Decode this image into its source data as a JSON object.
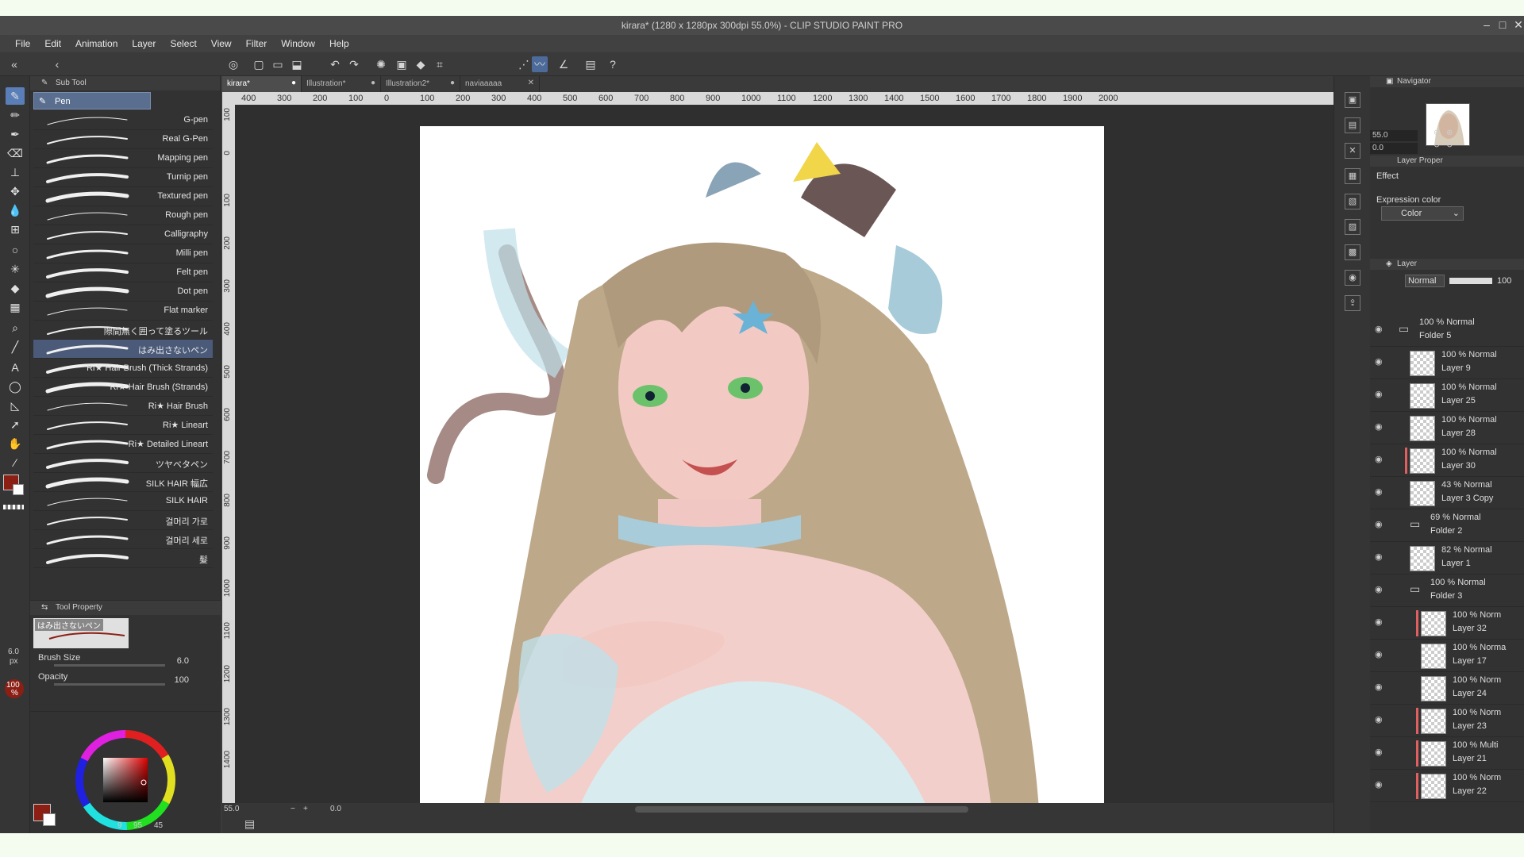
{
  "window": {
    "title": "kirara* (1280 x 1280px 300dpi 55.0%) - CLIP STUDIO PAINT PRO"
  },
  "menu": [
    "File",
    "Edit",
    "Animation",
    "Layer",
    "Select",
    "View",
    "Filter",
    "Window",
    "Help"
  ],
  "subtool": {
    "header": "Sub Tool",
    "active_tab": "Pen",
    "brushes": [
      {
        "label": "G-pen"
      },
      {
        "label": "Real G-Pen"
      },
      {
        "label": "Mapping pen"
      },
      {
        "label": "Turnip pen"
      },
      {
        "label": "Textured pen"
      },
      {
        "label": "Rough pen"
      },
      {
        "label": "Calligraphy"
      },
      {
        "label": "Milli pen"
      },
      {
        "label": "Felt pen"
      },
      {
        "label": "Dot pen"
      },
      {
        "label": "Flat marker"
      },
      {
        "label": "隙間無く囲って塗るツール"
      },
      {
        "label": "はみ出さないペン",
        "selected": true
      },
      {
        "label": "Ri★ Hair Brush (Thick Strands)"
      },
      {
        "label": "Ri★ Hair Brush (Strands)"
      },
      {
        "label": "Ri★ Hair Brush"
      },
      {
        "label": "Ri★ Lineart"
      },
      {
        "label": "Ri★ Detailed Lineart"
      },
      {
        "label": "ツヤベタペン"
      },
      {
        "label": "SILK HAIR 幅広"
      },
      {
        "label": "SILK HAIR"
      },
      {
        "label": "걸머리 가로"
      },
      {
        "label": "걸머리 세로"
      },
      {
        "label": "髮"
      }
    ]
  },
  "tool_property": {
    "header": "Tool Property",
    "preview_name": "はみ出さないペン",
    "brush_size_label": "Brush Size",
    "brush_size_value": "6.0",
    "opacity_label": "Opacity",
    "opacity_value": "100"
  },
  "left_status": {
    "size": "6.0",
    "size_unit": "px",
    "opacity": "100",
    "opacity_unit": "%"
  },
  "color": {
    "main": "#8b1f14",
    "sub": "#ffffff",
    "hsv": [
      "9",
      "95",
      "45"
    ]
  },
  "tabs": [
    "kirara*",
    "Illustration*",
    "Illustration2*",
    "naviaaaaa"
  ],
  "ruler_h": [
    "400",
    "300",
    "200",
    "100",
    "0",
    "100",
    "200",
    "300",
    "400",
    "500",
    "600",
    "700",
    "800",
    "900",
    "1000",
    "1100",
    "1200",
    "1300",
    "1400",
    "1500",
    "1600",
    "1700",
    "1800",
    "1900",
    "2000"
  ],
  "ruler_v": [
    "100",
    "0",
    "100",
    "200",
    "300",
    "400",
    "500",
    "600",
    "700",
    "800",
    "900",
    "1000",
    "1100",
    "1200",
    "1300",
    "1400"
  ],
  "canvas_status": {
    "zoom": "55.0",
    "angle": "0.0"
  },
  "navigator": {
    "header": "Navigator",
    "zoom": "55.0",
    "angle": "0.0"
  },
  "layer_property": {
    "header": "Layer Proper",
    "effect_label": "Effect",
    "expression_label": "Expression color",
    "expression_value": "Color"
  },
  "layer_panel": {
    "header": "Layer",
    "blend_mode": "Normal",
    "opacity": "100",
    "layers": [
      {
        "mode": "100 % Normal",
        "name": "Folder 5",
        "folder": true,
        "indent": 0
      },
      {
        "mode": "100 % Normal",
        "name": "Layer 9",
        "indent": 1
      },
      {
        "mode": "100 % Normal",
        "name": "Layer 25",
        "indent": 1
      },
      {
        "mode": "100 % Normal",
        "name": "Layer 28",
        "indent": 1
      },
      {
        "mode": "100 % Normal",
        "name": "Layer 30",
        "indent": 1,
        "marked": true
      },
      {
        "mode": "43 % Normal",
        "name": "Layer 3 Copy",
        "indent": 1
      },
      {
        "mode": "69 % Normal",
        "name": "Folder 2",
        "folder": true,
        "indent": 1
      },
      {
        "mode": "82 % Normal",
        "name": "Layer 1",
        "indent": 1
      },
      {
        "mode": "100 % Normal",
        "name": "Folder 3",
        "folder": true,
        "indent": 1
      },
      {
        "mode": "100 % Norm",
        "name": "Layer 32",
        "indent": 2,
        "marked": true
      },
      {
        "mode": "100 % Norma",
        "name": "Layer 17",
        "indent": 2
      },
      {
        "mode": "100 % Norm",
        "name": "Layer 24",
        "indent": 2
      },
      {
        "mode": "100 % Norm",
        "name": "Layer 23",
        "indent": 2,
        "marked": true
      },
      {
        "mode": "100 % Multi",
        "name": "Layer 21",
        "indent": 2,
        "marked": true
      },
      {
        "mode": "100 % Norm",
        "name": "Layer 22",
        "indent": 2,
        "marked": true
      }
    ]
  }
}
